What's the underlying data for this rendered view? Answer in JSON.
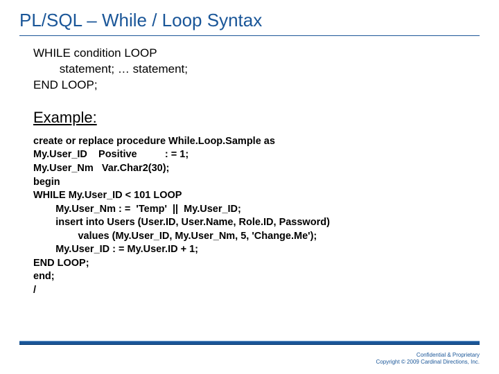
{
  "title": "PL/SQL – While / Loop Syntax",
  "syntax": {
    "l1": "WHILE condition LOOP",
    "l2": "        statement; … statement;",
    "l3": "END LOOP;"
  },
  "example_heading": "Example:",
  "code": {
    "l1": "create or replace procedure While.Loop.Sample as",
    "l2": "My.User_ID    Positive          : = 1;",
    "l3": "My.User_Nm   Var.Char2(30);",
    "l4": "begin",
    "l5": "WHILE My.User_ID < 101 LOOP",
    "l6": "        My.User_Nm : =  'Temp'  ||  My.User_ID;",
    "l7": "        insert into Users (User.ID, User.Name, Role.ID, Password)",
    "l8": "                values (My.User_ID, My.User_Nm, 5, 'Change.Me');",
    "l9": "        My.User_ID : = My.User.ID + 1;",
    "l10": "END LOOP;",
    "l11": "end;",
    "l12": "/"
  },
  "footer": {
    "line1": "Confidential & Proprietary",
    "line2": "Copyright © 2009 Cardinal Directions, Inc."
  }
}
